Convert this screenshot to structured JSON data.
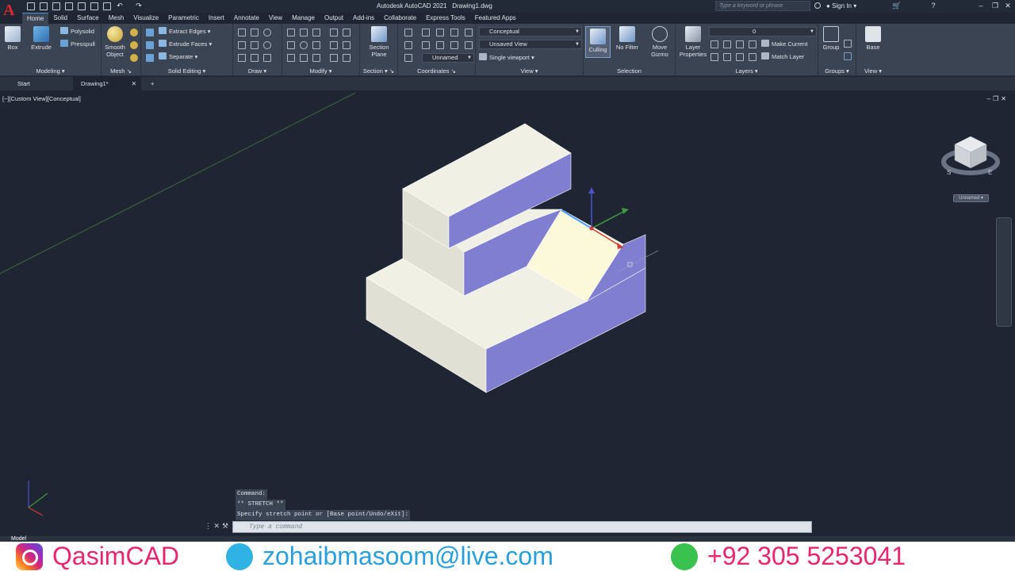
{
  "window": {
    "app_title": "Autodesk AutoCAD 2021",
    "file_name": "Drawing1.dwg",
    "search_placeholder": "Type a keyword or phrase",
    "sign_in": "Sign In"
  },
  "menu_tabs": [
    "Home",
    "Solid",
    "Surface",
    "Mesh",
    "Visualize",
    "Parametric",
    "Insert",
    "Annotate",
    "View",
    "Manage",
    "Output",
    "Add-ins",
    "Collaborate",
    "Express Tools",
    "Featured Apps"
  ],
  "ribbon": {
    "modeling": {
      "title": "Modeling",
      "box": "Box",
      "extrude": "Extrude",
      "polysolid": "Polysolid",
      "presspull": "Presspull"
    },
    "mesh": {
      "title": "Mesh",
      "smooth": "Smooth",
      "object": "Object"
    },
    "solid_editing": {
      "title": "Solid Editing",
      "extract_edges": "Extract Edges",
      "extrude_faces": "Extrude Faces",
      "separate": "Separate"
    },
    "draw": {
      "title": "Draw"
    },
    "modify": {
      "title": "Modify"
    },
    "section": {
      "title": "Section",
      "section_line1": "Section",
      "section_line2": "Plane"
    },
    "coordinates": {
      "title": "Coordinates",
      "ucs": "Unnamed"
    },
    "view": {
      "title": "View",
      "visual_style": "Conceptual",
      "named_view": "Unsaved View",
      "viewport": "Single viewport"
    },
    "selection": {
      "title": "Selection",
      "culling": "Culling",
      "no_filter": "No Filter",
      "move_line1": "Move",
      "move_line2": "Gizmo"
    },
    "layers": {
      "title": "Layers",
      "layer_props_line1": "Layer",
      "layer_props_line2": "Properties",
      "layer_value": "0",
      "make_current": "Make Current",
      "match_layer": "Match Layer"
    },
    "groups": {
      "title": "Groups",
      "group": "Group"
    },
    "view2": {
      "title": "View",
      "base": "Base"
    }
  },
  "file_tabs": {
    "start": "Start",
    "drawing": "Drawing1*"
  },
  "viewport": {
    "label": "[−][Custom View][Conceptual]",
    "ucs_name": "Unnamed"
  },
  "colors": {
    "face_light": "#ecebdf",
    "face_top": "#f1f0e4",
    "face_purple": "#7f7ed1",
    "face_slope": "#fbf9da",
    "background": "#1f2533"
  },
  "command": {
    "history": [
      "Command:",
      "** STRETCH **",
      "Specify stretch point or [Base point/Undo/eXit]:"
    ],
    "placeholder": "Type a command"
  },
  "status": {
    "model_tab": "Model"
  },
  "banner": {
    "instagram": "QasimCAD",
    "email": "zohaibmasoom@live.com",
    "phone": "+92 305 5253041"
  }
}
